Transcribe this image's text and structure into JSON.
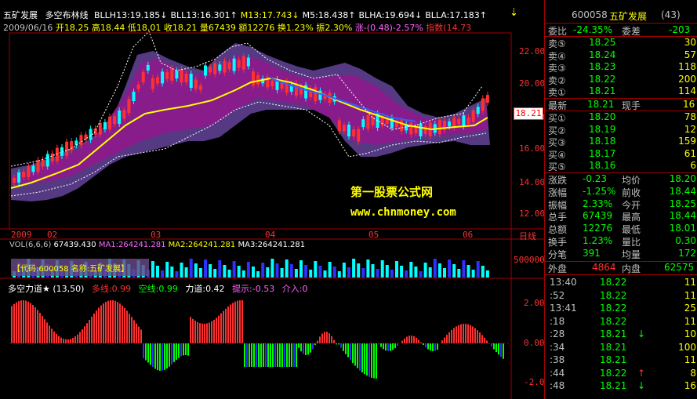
{
  "header": {
    "stock_name": "五矿发展",
    "indicator_name": "多空布林线",
    "bands": [
      {
        "label": "BLLH13:",
        "value": "19.185",
        "color": "#ffffff"
      },
      {
        "label": "BLL13:",
        "value": "16.301",
        "color": "#ffffff"
      },
      {
        "label": "M13:",
        "value": "17.743",
        "color": "#ffff00"
      },
      {
        "label": "M5:",
        "value": "18.438",
        "color": "#ffffff"
      },
      {
        "label": "BLHA:",
        "value": "19.694",
        "color": "#ffffff"
      },
      {
        "label": "BLLA:",
        "value": "17.183",
        "color": "#ffffff"
      }
    ],
    "date": "2009/06/16",
    "open": "开18.25",
    "high": "高18.44",
    "low": "低18.01",
    "close": "收18.21",
    "volume": "量67439",
    "amount": "额12276",
    "turnover": "换1.23%",
    "amplitude": "振2.30%",
    "change": "涨-(0.48)-2.57%",
    "index": "指数(14.73"
  },
  "watermark": {
    "line1": "第一股票公式网",
    "line2": "www.chnmoney.com"
  },
  "price_axis": [
    "22.00",
    "20.00",
    "18.00",
    "16.00",
    "14.00",
    "12.00"
  ],
  "current_price_tag": "18.21",
  "time_axis": [
    "2009",
    "02",
    "03",
    "04",
    "05",
    "06"
  ],
  "period_label": "日线",
  "volume_header": {
    "vol": "VOL(6,6,6)",
    "vol_value": "67439.430",
    "ma1": "MA1:264241.281",
    "ma2": "MA2:264241.281",
    "ma3": "MA3:264241.281",
    "code_overlay": "【代码:600058 名称:五矿发展】"
  },
  "volume_axis": "500000",
  "power_header": {
    "name": "多空力道★",
    "params": "(13,50)",
    "duo_label": "多线:0.99",
    "kong_label": "空线:0.99",
    "power_label": "力道:0.42",
    "hint_label": "提示:-0.53",
    "enter_label": "介入:0"
  },
  "power_axis": [
    "2.00",
    "0.00",
    "-2.00"
  ],
  "quote": {
    "code": "600058",
    "name": "五矿发展",
    "count": "(43)",
    "ratio_label": "委比",
    "ratio_value": "-24.35%",
    "diff_label": "委差",
    "diff_value": "-203",
    "asks": [
      {
        "label": "卖⑤",
        "price": "18.25",
        "vol": "30"
      },
      {
        "label": "卖④",
        "price": "18.24",
        "vol": "57"
      },
      {
        "label": "卖③",
        "price": "18.23",
        "vol": "118"
      },
      {
        "label": "卖②",
        "price": "18.22",
        "vol": "200"
      },
      {
        "label": "卖①",
        "price": "18.21",
        "vol": "114"
      }
    ],
    "last_label": "最新",
    "last_value": "18.21",
    "hand_label": "现手",
    "hand_value": "16",
    "bids": [
      {
        "label": "买①",
        "price": "18.20",
        "vol": "78"
      },
      {
        "label": "买②",
        "price": "18.19",
        "vol": "12"
      },
      {
        "label": "买③",
        "price": "18.18",
        "vol": "159"
      },
      {
        "label": "买④",
        "price": "18.17",
        "vol": "61"
      },
      {
        "label": "买⑤",
        "price": "18.16",
        "vol": "6"
      }
    ],
    "stats": [
      {
        "l1": "涨跌",
        "v1": "-0.23",
        "l2": "均价",
        "v2": "18.20"
      },
      {
        "l1": "涨幅",
        "v1": "-1.25%",
        "l2": "前收",
        "v2": "18.44"
      },
      {
        "l1": "振幅",
        "v1": "2.33%",
        "l2": "今开",
        "v2": "18.25"
      },
      {
        "l1": "总手",
        "v1": "67439",
        "l2": "最高",
        "v2": "18.44"
      },
      {
        "l1": "总额",
        "v1": "12276",
        "l2": "最低",
        "v2": "18.01"
      },
      {
        "l1": "换手",
        "v1": "1.23%",
        "l2": "量比",
        "v2": "0.30"
      },
      {
        "l1": "分笔",
        "v1": "391",
        "l2": "均量",
        "v2": "172"
      }
    ],
    "outer_label": "外盘",
    "outer_value": "4864",
    "inner_label": "内盘",
    "inner_value": "62575"
  },
  "ticks": [
    {
      "time": "13:40",
      "price": "18.22",
      "vol": "11",
      "arrow": ""
    },
    {
      "time": ":52",
      "price": "18.22",
      "vol": "11",
      "arrow": ""
    },
    {
      "time": "13:41",
      "price": "18.22",
      "vol": "25",
      "arrow": ""
    },
    {
      "time": ":18",
      "price": "18.22",
      "vol": "11",
      "arrow": ""
    },
    {
      "time": ":28",
      "price": "18.21",
      "vol": "10",
      "arrow": "↓"
    },
    {
      "time": ":34",
      "price": "18.21",
      "vol": "100",
      "arrow": ""
    },
    {
      "time": ":38",
      "price": "18.21",
      "vol": "11",
      "arrow": ""
    },
    {
      "time": ":44",
      "price": "18.22",
      "vol": "8",
      "arrow": "↑"
    },
    {
      "time": ":48",
      "price": "18.21",
      "vol": "16",
      "arrow": "↓"
    }
  ],
  "colors": {
    "up": "#ff3030",
    "down": "#00ffff",
    "ma_yellow": "#ffff00",
    "band_fill": "#8b1a8b",
    "band_fill2": "#5a3d8a",
    "axis_red": "#a00000",
    "green": "#00ff00",
    "blue": "#3030ff"
  }
}
